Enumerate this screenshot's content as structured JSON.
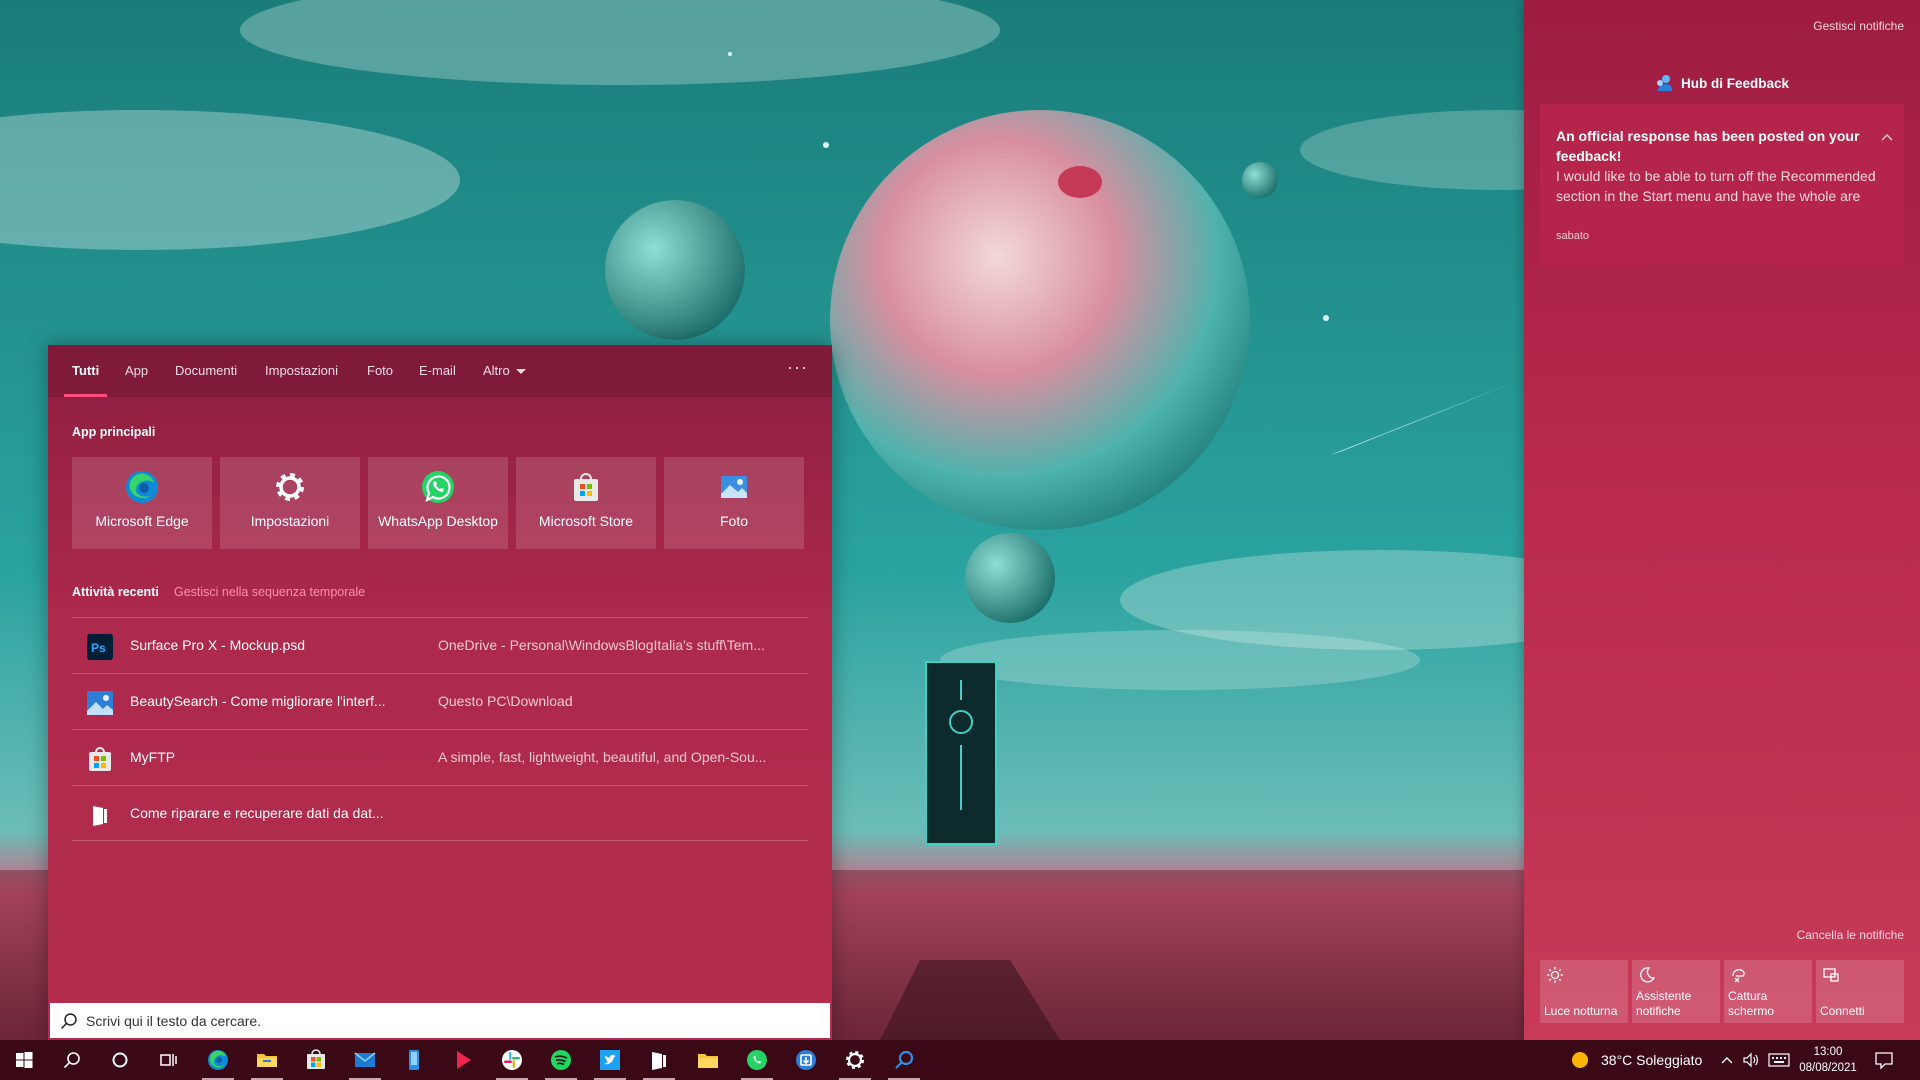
{
  "search_panel": {
    "tabs": [
      {
        "label": "Tutti",
        "active": true
      },
      {
        "label": "App"
      },
      {
        "label": "Documenti"
      },
      {
        "label": "Impostazioni"
      },
      {
        "label": "Foto"
      },
      {
        "label": "E-mail"
      },
      {
        "label": "Altro",
        "dropdown": true
      }
    ],
    "more_label": "···",
    "top_apps_title": "App principali",
    "top_apps": [
      {
        "label": "Microsoft Edge",
        "icon": "edge-icon"
      },
      {
        "label": "Impostazioni",
        "icon": "gear-icon"
      },
      {
        "label": "WhatsApp Desktop",
        "icon": "whatsapp-icon"
      },
      {
        "label": "Microsoft Store",
        "icon": "store-icon"
      },
      {
        "label": "Foto",
        "icon": "photos-icon"
      }
    ],
    "recent_title": "Attività recenti",
    "recent_link": "Gestisci nella sequenza temporale",
    "recent_items": [
      {
        "name": "Surface Pro X - Mockup.psd",
        "path": "OneDrive - Personal\\WindowsBlogItalia's stuff\\Tem...",
        "icon": "photoshop-icon"
      },
      {
        "name": "BeautySearch - Come migliorare l'interf...",
        "path": "Questo PC\\Download",
        "icon": "image-file-icon"
      },
      {
        "name": "MyFTP",
        "path": "A simple, fast, lightweight, beautiful, and Open-Sou...",
        "icon": "store-icon"
      },
      {
        "name": "Come riparare e recuperare dati da dat...",
        "path": "",
        "icon": "edge-dev-icon"
      }
    ],
    "search_placeholder": "Scrivi qui il testo da cercare."
  },
  "action_center": {
    "manage_label": "Gestisci notifiche",
    "app_name": "Hub di Feedback",
    "notification": {
      "title": "An official response has been posted on your feedback!",
      "body": "I would like to be able to turn off the Recommended section in the Start menu and have the whole are",
      "time": "sabato"
    },
    "clear_label": "Cancella le notifiche",
    "quick_actions": [
      {
        "label": "Luce notturna",
        "icon": "sun-icon"
      },
      {
        "label": "Assistente notifiche",
        "icon": "moon-icon"
      },
      {
        "label": "Cattura schermo",
        "icon": "snip-icon"
      },
      {
        "label": "Connetti",
        "icon": "cast-icon"
      }
    ]
  },
  "taskbar": {
    "weather_text": "38°C  Soleggiato",
    "time": "13:00",
    "date": "08/08/2021",
    "pinned": [
      "edge-icon",
      "file-explorer-icon",
      "store-icon",
      "mail-icon",
      "phone-icon",
      "media-player-icon",
      "slack-icon",
      "spotify-icon",
      "twitter-icon",
      "edge-dev-icon",
      "folder-icon",
      "whatsapp-icon",
      "app-installer-icon",
      "gear-icon",
      "search-app-icon"
    ]
  },
  "colors": {
    "accent": "#b42c4c",
    "taskbar": "#3a0915",
    "tab_indicator": "#ff4e7a",
    "link": "#ff8fab"
  }
}
